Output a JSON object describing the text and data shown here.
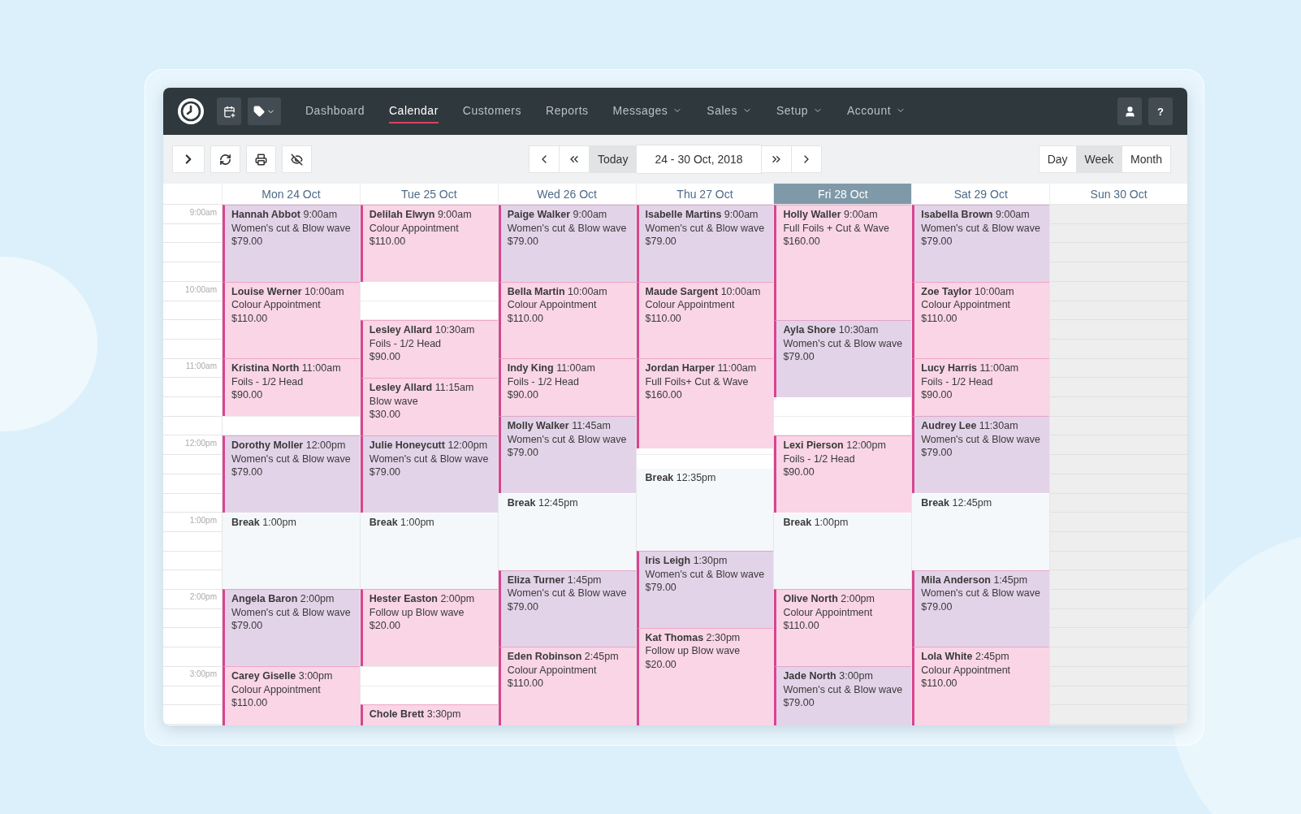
{
  "nav": {
    "items": [
      {
        "label": "Dashboard",
        "selected": false,
        "dropdown": false
      },
      {
        "label": "Calendar",
        "selected": true,
        "dropdown": false
      },
      {
        "label": "Customers",
        "selected": false,
        "dropdown": false
      },
      {
        "label": "Reports",
        "selected": false,
        "dropdown": false
      },
      {
        "label": "Messages",
        "selected": false,
        "dropdown": true
      },
      {
        "label": "Sales",
        "selected": false,
        "dropdown": true
      },
      {
        "label": "Setup",
        "selected": false,
        "dropdown": true
      },
      {
        "label": "Account",
        "selected": false,
        "dropdown": true
      }
    ],
    "help": "?"
  },
  "toolbar": {
    "today": "Today",
    "range": "24 - 30 Oct, 2018",
    "views": [
      {
        "label": "Day",
        "selected": false
      },
      {
        "label": "Week",
        "selected": true
      },
      {
        "label": "Month",
        "selected": false
      }
    ]
  },
  "times": [
    "9:00am",
    "10:00am",
    "11:00am",
    "12:00pm",
    "1:00pm",
    "2:00pm",
    "3:00pm"
  ],
  "days": [
    {
      "label": "Mon 24 Oct",
      "selected": false,
      "closed": false,
      "events": [
        {
          "kind": "appointment",
          "name": "Hannah Abbot",
          "time": "9:00am",
          "service": "Women's cut & Blow wave",
          "price": "$79.00",
          "color": "#e3d3e8"
        },
        {
          "kind": "appointment",
          "name": "Louise Werner",
          "time": "10:00am",
          "service": "Colour Appointment",
          "price": "$110.00",
          "color": "#f9d5e5"
        },
        {
          "kind": "appointment",
          "name": "Kristina North",
          "time": "11:00am",
          "service": "Foils - 1/2 Head",
          "price": "$90.00",
          "color": "#f9d5e5"
        },
        {
          "kind": "appointment",
          "name": "Dorothy Moller",
          "time": "12:00pm",
          "service": "Women's cut & Blow wave",
          "price": "$79.00",
          "color": "#e3d3e8"
        },
        {
          "kind": "break",
          "name": "Break",
          "time": "1:00pm"
        },
        {
          "kind": "appointment",
          "name": "Angela Baron",
          "time": "2:00pm",
          "service": "Women's cut & Blow wave",
          "price": "$79.00",
          "color": "#e3d3e8"
        },
        {
          "kind": "appointment",
          "name": "Carey Giselle",
          "time": "3:00pm",
          "service": "Colour Appointment",
          "price": "$110.00",
          "color": "#f9d5e5"
        }
      ]
    },
    {
      "label": "Tue 25 Oct",
      "selected": false,
      "closed": false,
      "events": [
        {
          "kind": "appointment",
          "name": "Delilah Elwyn",
          "time": "9:00am",
          "service": "Colour Appointment",
          "price": "$110.00",
          "color": "#f9d5e5"
        },
        {
          "kind": "appointment",
          "name": "Lesley Allard",
          "time": "10:30am",
          "service": "Foils - 1/2 Head",
          "price": "$90.00",
          "color": "#f9d5e5"
        },
        {
          "kind": "appointment",
          "name": "Lesley Allard",
          "time": "11:15am",
          "service": "Blow wave",
          "price": "$30.00",
          "color": "#f9d5e5"
        },
        {
          "kind": "appointment",
          "name": "Julie Honeycutt",
          "time": "12:00pm",
          "service": "Women's cut & Blow wave",
          "price": "$79.00",
          "color": "#e3d3e8"
        },
        {
          "kind": "break",
          "name": "Break",
          "time": "1:00pm"
        },
        {
          "kind": "appointment",
          "name": "Hester Easton",
          "time": "2:00pm",
          "service": "Follow up Blow wave",
          "price": "$20.00",
          "color": "#f9d5e5"
        },
        {
          "kind": "appointment",
          "name": "Chole Brett",
          "time": "3:30pm",
          "color": "#f9d5e5"
        }
      ]
    },
    {
      "label": "Wed 26 Oct",
      "selected": false,
      "closed": false,
      "events": [
        {
          "kind": "appointment",
          "name": "Paige Walker",
          "time": "9:00am",
          "service": "Women's cut & Blow wave",
          "price": "$79.00",
          "color": "#e3d3e8"
        },
        {
          "kind": "appointment",
          "name": "Bella Martin",
          "time": "10:00am",
          "service": "Colour Appointment",
          "price": "$110.00",
          "color": "#f9d5e5"
        },
        {
          "kind": "appointment",
          "name": "Indy King",
          "time": "11:00am",
          "service": "Foils - 1/2 Head",
          "price": "$90.00",
          "color": "#f9d5e5"
        },
        {
          "kind": "appointment",
          "name": "Molly Walker",
          "time": "11:45am",
          "service": "Women's cut & Blow wave",
          "price": "$79.00",
          "color": "#e3d3e8"
        },
        {
          "kind": "break",
          "name": "Break",
          "time": "12:45pm"
        },
        {
          "kind": "appointment",
          "name": "Eliza Turner",
          "time": "1:45pm",
          "service": "Women's cut & Blow wave",
          "price": "$79.00",
          "color": "#e3d3e8"
        },
        {
          "kind": "appointment",
          "name": "Eden Robinson",
          "time": "2:45pm",
          "service": "Colour Appointment",
          "price": "$110.00",
          "color": "#f9d5e5"
        }
      ]
    },
    {
      "label": "Thu 27 Oct",
      "selected": false,
      "closed": false,
      "events": [
        {
          "kind": "appointment",
          "name": "Isabelle Martins",
          "time": "9:00am",
          "service": "Women's cut & Blow wave",
          "price": "$79.00",
          "color": "#e3d3e8"
        },
        {
          "kind": "appointment",
          "name": "Maude Sargent",
          "time": "10:00am",
          "service": "Colour Appointment",
          "price": "$110.00",
          "color": "#f9d5e5"
        },
        {
          "kind": "appointment",
          "name": "Jordan Harper",
          "time": "11:00am",
          "service": "Full Foils+ Cut & Wave",
          "price": "$160.00",
          "color": "#f9d5e5"
        },
        {
          "kind": "break",
          "name": "Break",
          "time": "12:35pm"
        },
        {
          "kind": "appointment",
          "name": "Iris Leigh",
          "time": "1:30pm",
          "service": "Women's cut & Blow wave",
          "price": "$79.00",
          "color": "#e3d3e8"
        },
        {
          "kind": "appointment",
          "name": "Kat Thomas",
          "time": "2:30pm",
          "service": "Follow up Blow wave",
          "price": "$20.00",
          "color": "#f9d5e5"
        }
      ]
    },
    {
      "label": "Fri 28 Oct",
      "selected": true,
      "closed": false,
      "events": [
        {
          "kind": "appointment",
          "name": "Holly Waller",
          "time": "9:00am",
          "service": "Full Foils + Cut & Wave",
          "price": "$160.00",
          "color": "#f9d5e5"
        },
        {
          "kind": "appointment",
          "name": "Ayla Shore",
          "time": "10:30am",
          "service": "Women's cut & Blow wave",
          "price": "$79.00",
          "color": "#e3d3e8"
        },
        {
          "kind": "appointment",
          "name": "Lexi Pierson",
          "time": "12:00pm",
          "service": "Foils - 1/2 Head",
          "price": "$90.00",
          "color": "#f9d5e5"
        },
        {
          "kind": "break",
          "name": "Break",
          "time": "1:00pm"
        },
        {
          "kind": "appointment",
          "name": "Olive North",
          "time": "2:00pm",
          "service": "Colour Appointment",
          "price": "$110.00",
          "color": "#f9d5e5"
        },
        {
          "kind": "appointment",
          "name": "Jade North",
          "time": "3:00pm",
          "service": "Women's cut & Blow wave",
          "price": "$79.00",
          "color": "#e3d3e8"
        }
      ]
    },
    {
      "label": "Sat 29 Oct",
      "selected": false,
      "closed": false,
      "events": [
        {
          "kind": "appointment",
          "name": "Isabella Brown",
          "time": "9:00am",
          "service": "Women's cut & Blow wave",
          "price": "$79.00",
          "color": "#e3d3e8"
        },
        {
          "kind": "appointment",
          "name": "Zoe Taylor",
          "time": "10:00am",
          "service": "Colour Appointment",
          "price": "$110.00",
          "color": "#f9d5e5"
        },
        {
          "kind": "appointment",
          "name": "Lucy Harris",
          "time": "11:00am",
          "service": "Foils - 1/2 Head",
          "price": "$90.00",
          "color": "#f9d5e5"
        },
        {
          "kind": "appointment",
          "name": "Audrey Lee",
          "time": "11:30am",
          "service": "Women's cut & Blow wave",
          "price": "$79.00",
          "color": "#e3d3e8"
        },
        {
          "kind": "break",
          "name": "Break",
          "time": "12:45pm"
        },
        {
          "kind": "appointment",
          "name": "Mila Anderson",
          "time": "1:45pm",
          "service": "Women's cut & Blow wave",
          "price": "$79.00",
          "color": "#e3d3e8"
        },
        {
          "kind": "appointment",
          "name": "Lola White",
          "time": "2:45pm",
          "service": "Colour Appointment",
          "price": "$110.00",
          "color": "#f9d5e5"
        }
      ]
    },
    {
      "label": "Sun 30 Oct",
      "selected": false,
      "closed": true
    }
  ]
}
